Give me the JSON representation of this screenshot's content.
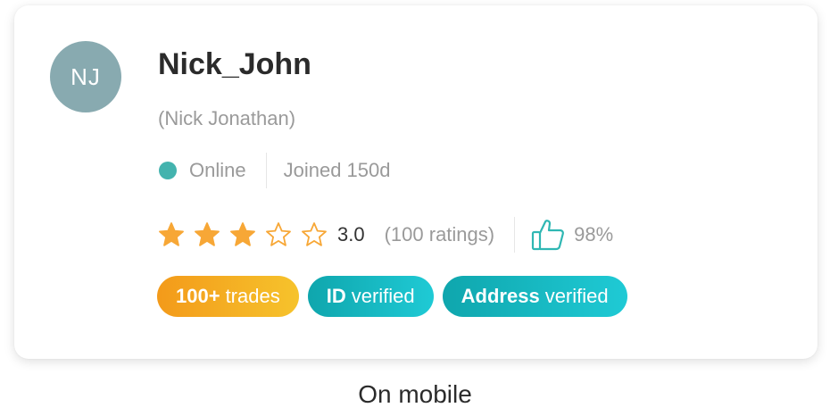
{
  "profile": {
    "initials": "NJ",
    "username": "Nick_John",
    "full_name": "(Nick Jonathan)",
    "status": "Online",
    "joined": "Joined 150d"
  },
  "rating": {
    "value_text": "3.0",
    "stars_filled": 3,
    "stars_total": 5,
    "count_text": "(100 ratings)",
    "approval": "98%"
  },
  "badges": [
    {
      "bold": "100+",
      "text": "trades"
    },
    {
      "bold": "ID",
      "text": "verified"
    },
    {
      "bold": "Address",
      "text": "verified"
    }
  ],
  "caption": "On mobile",
  "icons": {
    "status": "online-dot-icon",
    "star": "star-icon",
    "approval": "thumbs-up-icon"
  },
  "colors": {
    "avatar": "#88aab0",
    "online": "#43b3ae",
    "star": "#f7a736",
    "thumb": "#2fb7b3",
    "badge_trades_start": "#f39a1a",
    "badge_trades_end": "#f6c32c",
    "badge_verified_start": "#0fa6ad",
    "badge_verified_end": "#1fcad5"
  }
}
